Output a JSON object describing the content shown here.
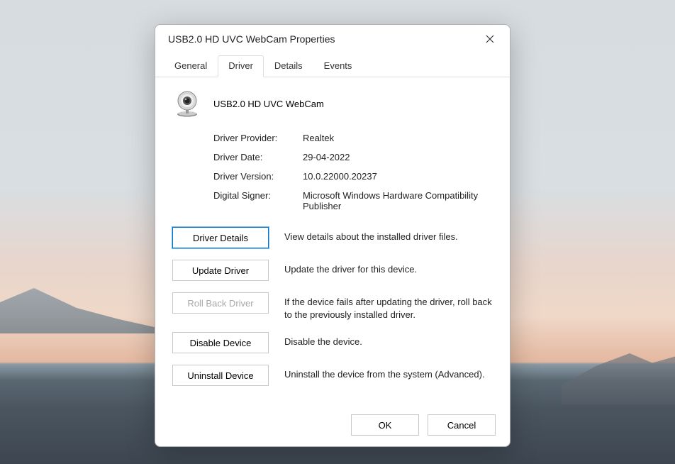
{
  "dialog": {
    "title": "USB2.0 HD UVC WebCam Properties"
  },
  "tabs": [
    {
      "label": "General"
    },
    {
      "label": "Driver"
    },
    {
      "label": "Details"
    },
    {
      "label": "Events"
    }
  ],
  "activeTab": 1,
  "device": {
    "name": "USB2.0 HD UVC WebCam"
  },
  "driverInfo": {
    "providerLabel": "Driver Provider:",
    "providerValue": "Realtek",
    "dateLabel": "Driver Date:",
    "dateValue": "29-04-2022",
    "versionLabel": "Driver Version:",
    "versionValue": "10.0.22000.20237",
    "signerLabel": "Digital Signer:",
    "signerValue": "Microsoft Windows Hardware Compatibility Publisher"
  },
  "actions": {
    "details": {
      "label": "Driver Details",
      "desc": "View details about the installed driver files."
    },
    "update": {
      "label": "Update Driver",
      "desc": "Update the driver for this device."
    },
    "rollback": {
      "label": "Roll Back Driver",
      "desc": "If the device fails after updating the driver, roll back to the previously installed driver."
    },
    "disable": {
      "label": "Disable Device",
      "desc": "Disable the device."
    },
    "uninstall": {
      "label": "Uninstall Device",
      "desc": "Uninstall the device from the system (Advanced)."
    }
  },
  "footer": {
    "ok": "OK",
    "cancel": "Cancel"
  }
}
